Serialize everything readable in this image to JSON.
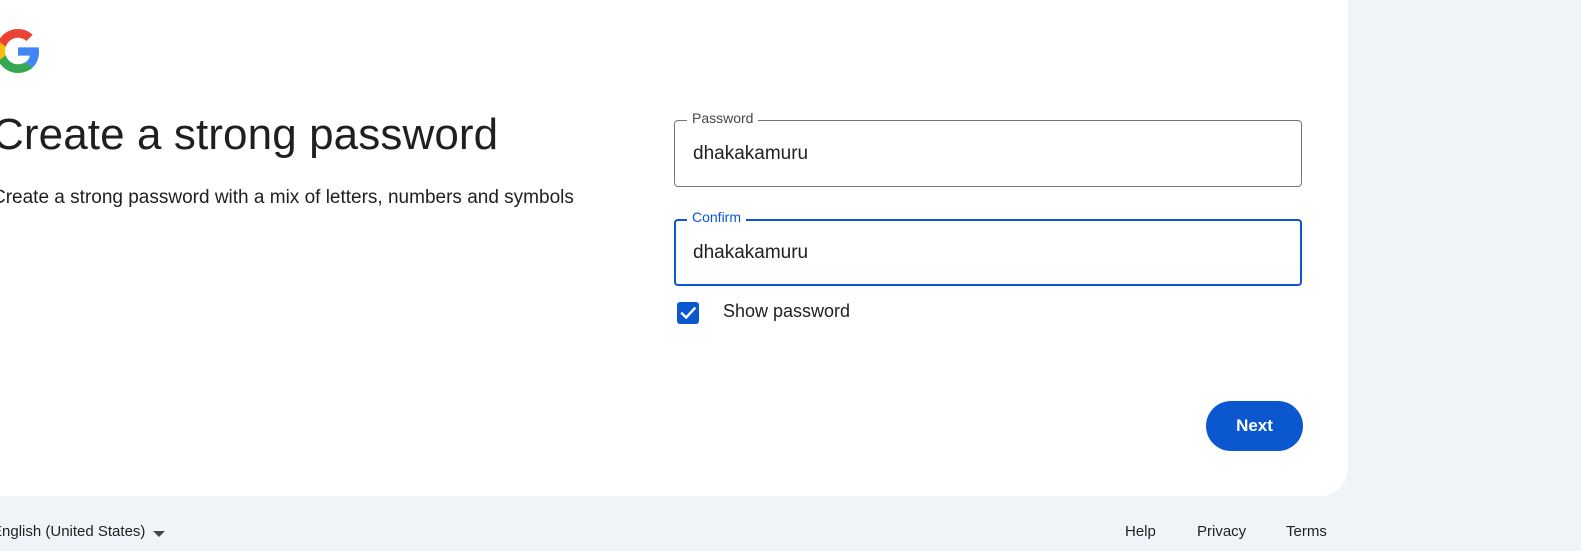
{
  "header": {
    "title": "Create a strong password",
    "subtitle": "Create a strong password with a mix of letters, numbers and symbols"
  },
  "form": {
    "password": {
      "label": "Password",
      "value": "dhakakamuru"
    },
    "confirm": {
      "label": "Confirm",
      "value": "dhakakamuru"
    },
    "show_password": {
      "label": "Show password",
      "checked": true
    },
    "next_label": "Next"
  },
  "footer": {
    "language": "English (United States)",
    "links": {
      "help": "Help",
      "privacy": "Privacy",
      "terms": "Terms"
    }
  },
  "icons": {
    "logo": "google-g-logo",
    "checkbox": "checkmark-icon",
    "dropdown": "caret-down-icon"
  },
  "colors": {
    "accent": "#0b57d0",
    "page_background": "#f0f4f9",
    "card_background": "#ffffff",
    "text": "#1f1f1f"
  }
}
